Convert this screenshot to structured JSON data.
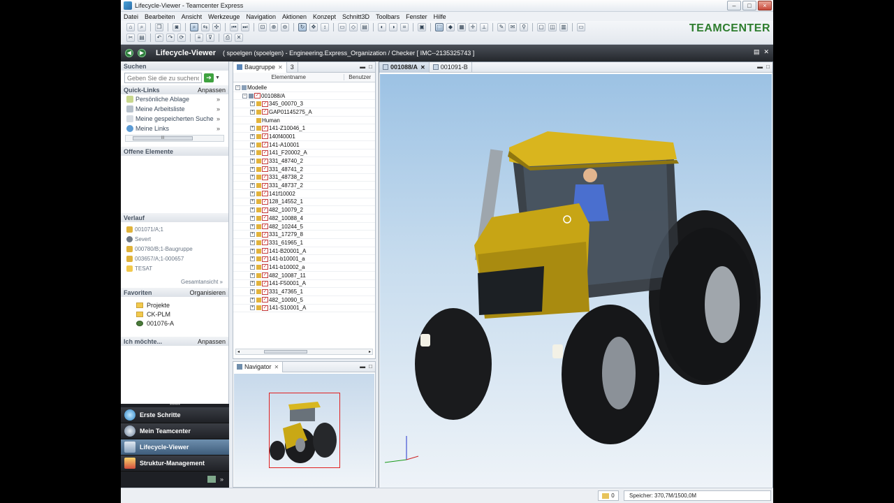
{
  "window": {
    "title": "Lifecycle-Viewer - Teamcenter Express"
  },
  "menu": [
    "Datei",
    "Bearbeiten",
    "Ansicht",
    "Werkzeuge",
    "Navigation",
    "Aktionen",
    "Konzept",
    "Schnitt3D",
    "Toolbars",
    "Fenster",
    "Hilfe"
  ],
  "brand": "TEAMCENTER",
  "perspective": {
    "title": "Lifecycle-Viewer",
    "context": "( spoelgen (spoelgen) - Engineering.Express_Organization / Checker  [ IMC--2135325743 ]"
  },
  "left": {
    "search": {
      "header": "Suchen",
      "placeholder": "Geben Sie die zu suchende"
    },
    "quicklinks": {
      "header": "Quick-Links",
      "action": "Anpassen",
      "items": [
        "Persönliche Ablage",
        "Meine Arbeitsliste",
        "Meine gespeicherten Suche",
        "Meine Links"
      ]
    },
    "open": {
      "header": "Offene Elemente"
    },
    "history": {
      "header": "Verlauf",
      "items": [
        "001071/A;1",
        "Severt",
        "000780/B;1-Baugruppe",
        "003657/A;1-000657",
        "TESAT"
      ],
      "more": "Gesamtansicht"
    },
    "favorites": {
      "header": "Favoriten",
      "action": "Organisieren",
      "items": [
        "Projekte",
        "CK-PLM",
        "001076-A"
      ]
    },
    "wants": {
      "header": "Ich möchte...",
      "action": "Anpassen"
    }
  },
  "navbuttons": [
    "Erste Schritte",
    "Mein Teamcenter",
    "Lifecycle-Viewer",
    "Struktur-Management"
  ],
  "tree": {
    "tab": "Baugruppe",
    "tab2": "3",
    "col1": "Elementname",
    "col2": "Benutzer",
    "root": "Modelle",
    "assembly": "001088/A",
    "items": [
      "345_00070_3",
      "GAP01145275_A",
      "Human",
      "141-Z10046_1",
      "140f40001",
      "141-A10001",
      "141_F20002_A",
      "331_48740_2",
      "331_48741_2",
      "331_48738_2",
      "331_48737_2",
      "141f10002",
      "128_14552_1",
      "482_10079_2",
      "482_10088_4",
      "482_10244_5",
      "331_17279_8",
      "331_61965_1",
      "141-B20001_A",
      "141-b10001_a",
      "141-b10002_a",
      "482_10087_11",
      "141-F50001_A",
      "331_47365_1",
      "482_10090_5",
      "141-S10001_A"
    ]
  },
  "navigator": {
    "tab": "Navigator"
  },
  "viewer": {
    "tabs": [
      "001088/A",
      "001091-B"
    ]
  },
  "status": {
    "count": "0",
    "memory": "Speicher: 370,7M/1500,0M"
  }
}
